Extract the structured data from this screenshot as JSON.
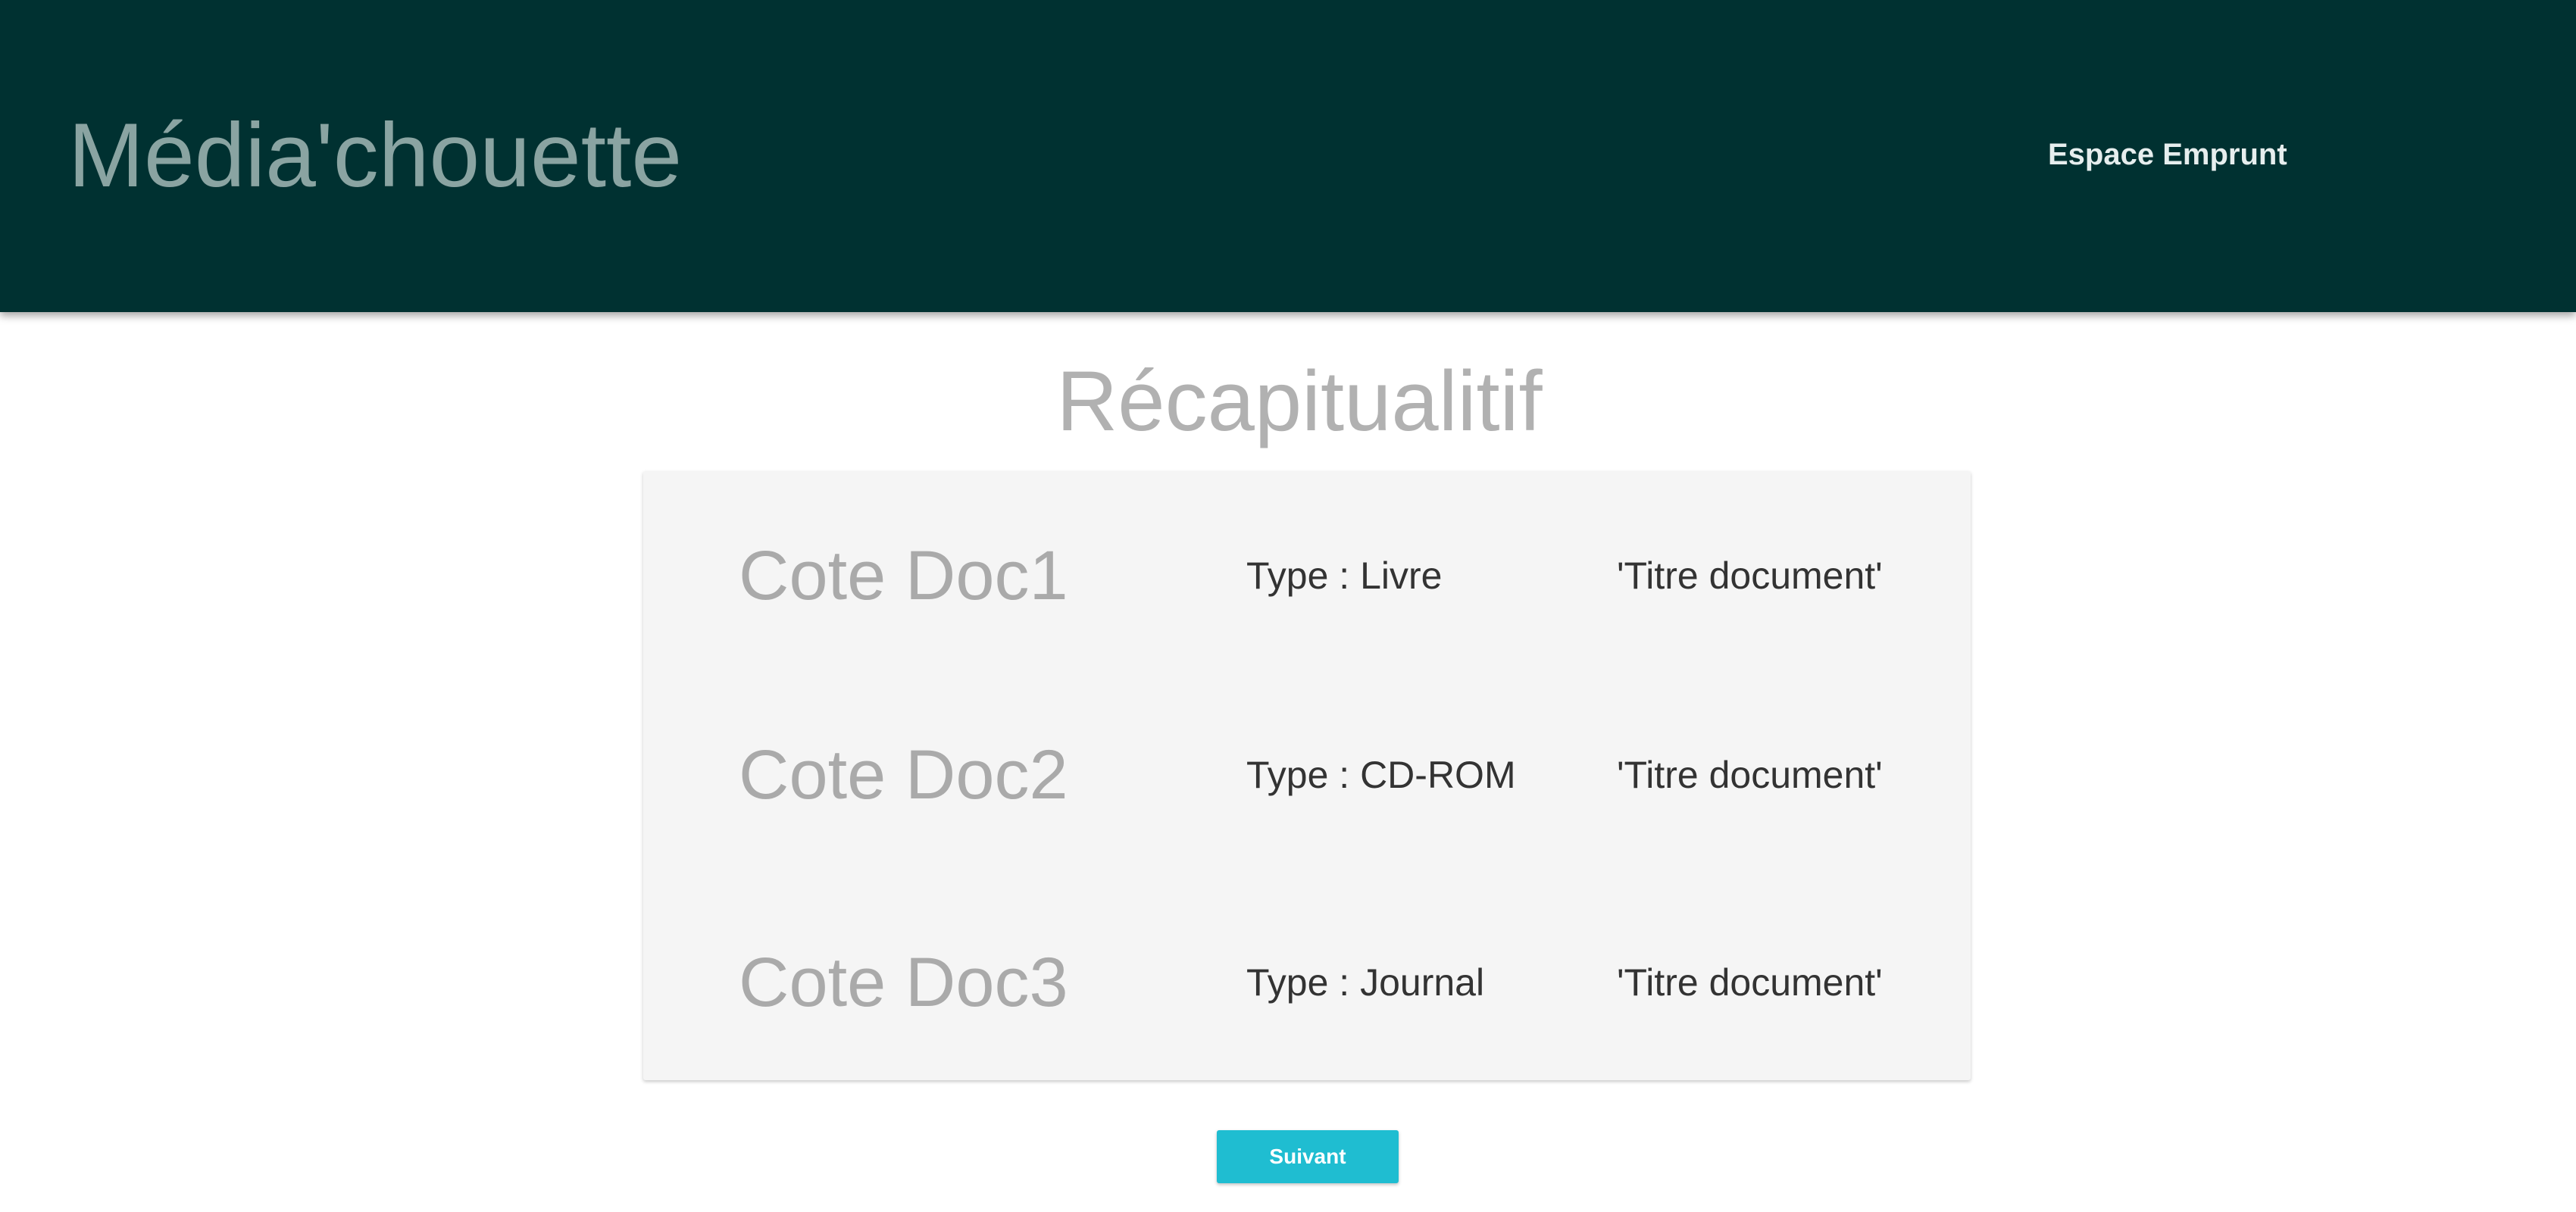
{
  "header": {
    "brand": "Média'chouette",
    "nav_link": "Espace Emprunt"
  },
  "main": {
    "title": "Récapitualitif",
    "documents": [
      {
        "code": "Cote Doc1",
        "type": "Type : Livre",
        "title": "'Titre document'"
      },
      {
        "code": "Cote Doc2",
        "type": "Type : CD-ROM",
        "title": "'Titre document'"
      },
      {
        "code": "Cote Doc3",
        "type": "Type : Journal",
        "title": "'Titre document'"
      }
    ],
    "next_button": "Suivant"
  },
  "colors": {
    "header_background": "#003131",
    "button_accent": "#1fbdd1",
    "panel_background": "#f5f5f5"
  }
}
